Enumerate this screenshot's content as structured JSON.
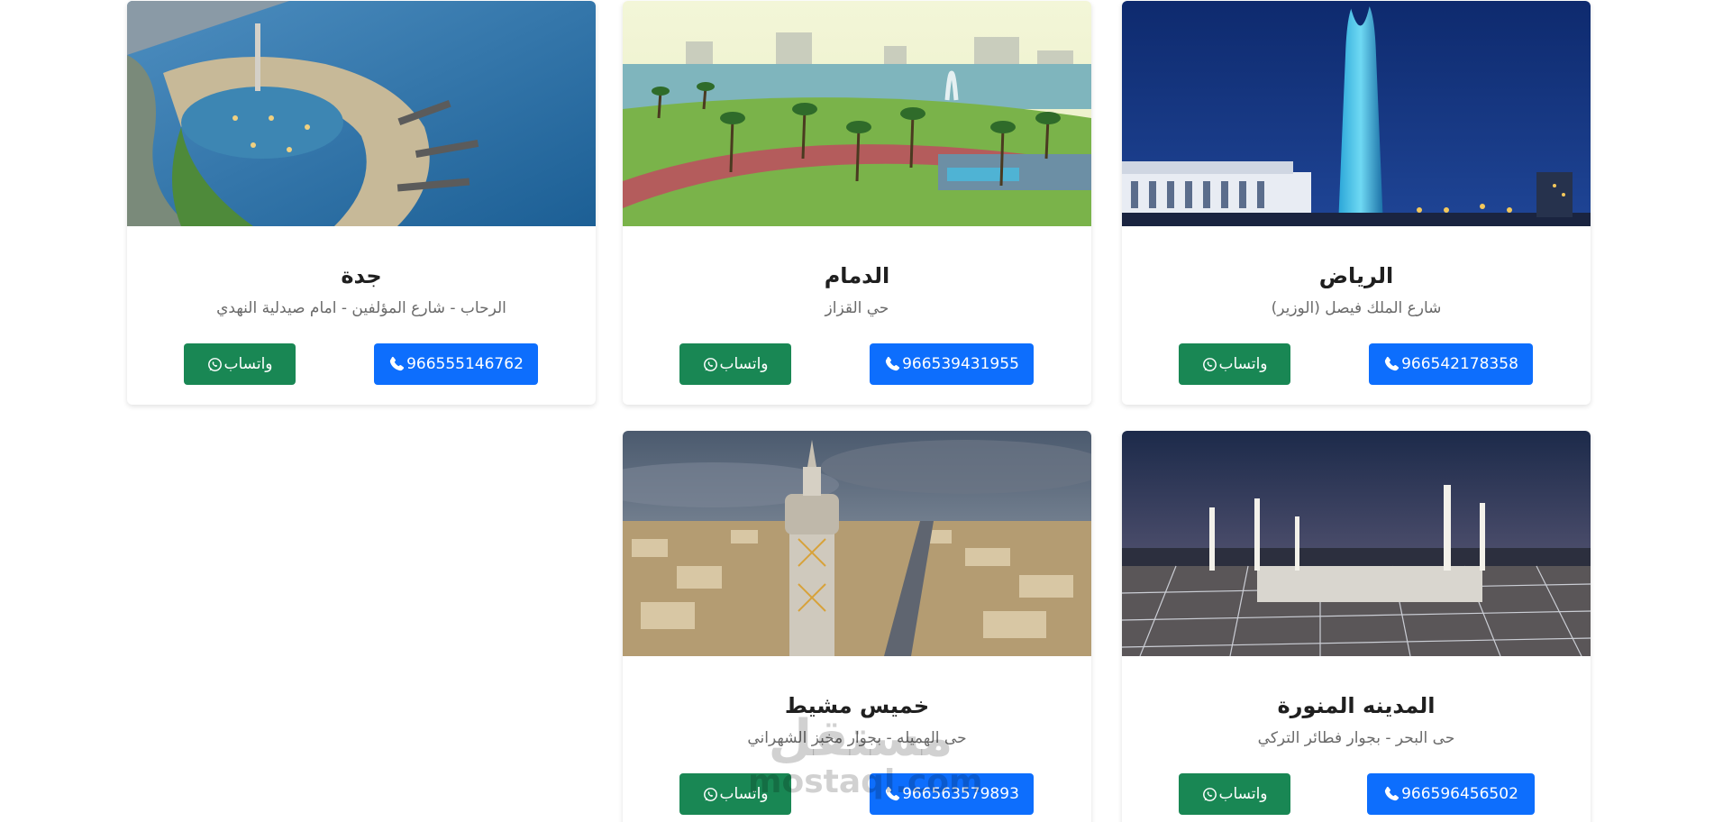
{
  "branches": [
    {
      "city": "الرياض",
      "address": "شارع الملك فيصل (الوزير)",
      "phone": "966542178358",
      "whatsapp_label": "واتساب",
      "image_alt": "riyadh-kingdom-tower-night"
    },
    {
      "city": "الدمام",
      "address": "حي القزاز",
      "phone": "966539431955",
      "whatsapp_label": "واتساب",
      "image_alt": "dammam-corniche-palms"
    },
    {
      "city": "جدة",
      "address": "الرحاب - شارع المؤلفين - امام صيدلية النهدي",
      "phone": "966555146762",
      "whatsapp_label": "واتساب",
      "image_alt": "jeddah-corniche-sea"
    },
    {
      "city": "المدينه المنورة",
      "address": "حى البحر - بجوار فطائر التركي",
      "phone": "966596456502",
      "whatsapp_label": "واتساب",
      "image_alt": "madinah-prophets-mosque"
    },
    {
      "city": "خميس مشيط",
      "address": "حى الهميله - بجوار مخبز الشهراني",
      "phone": "966563579893",
      "whatsapp_label": "واتساب",
      "image_alt": "khamis-mushait-water-tower"
    }
  ],
  "watermark": {
    "arabic": "مستقل",
    "latin": "mostaql.com"
  },
  "colors": {
    "phone_button": "#0d6efd",
    "whatsapp_button": "#198754",
    "title": "#1f1f1f",
    "address": "#6a6a6a"
  },
  "icons": {
    "phone": "phone-icon",
    "whatsapp": "whatsapp-icon"
  }
}
